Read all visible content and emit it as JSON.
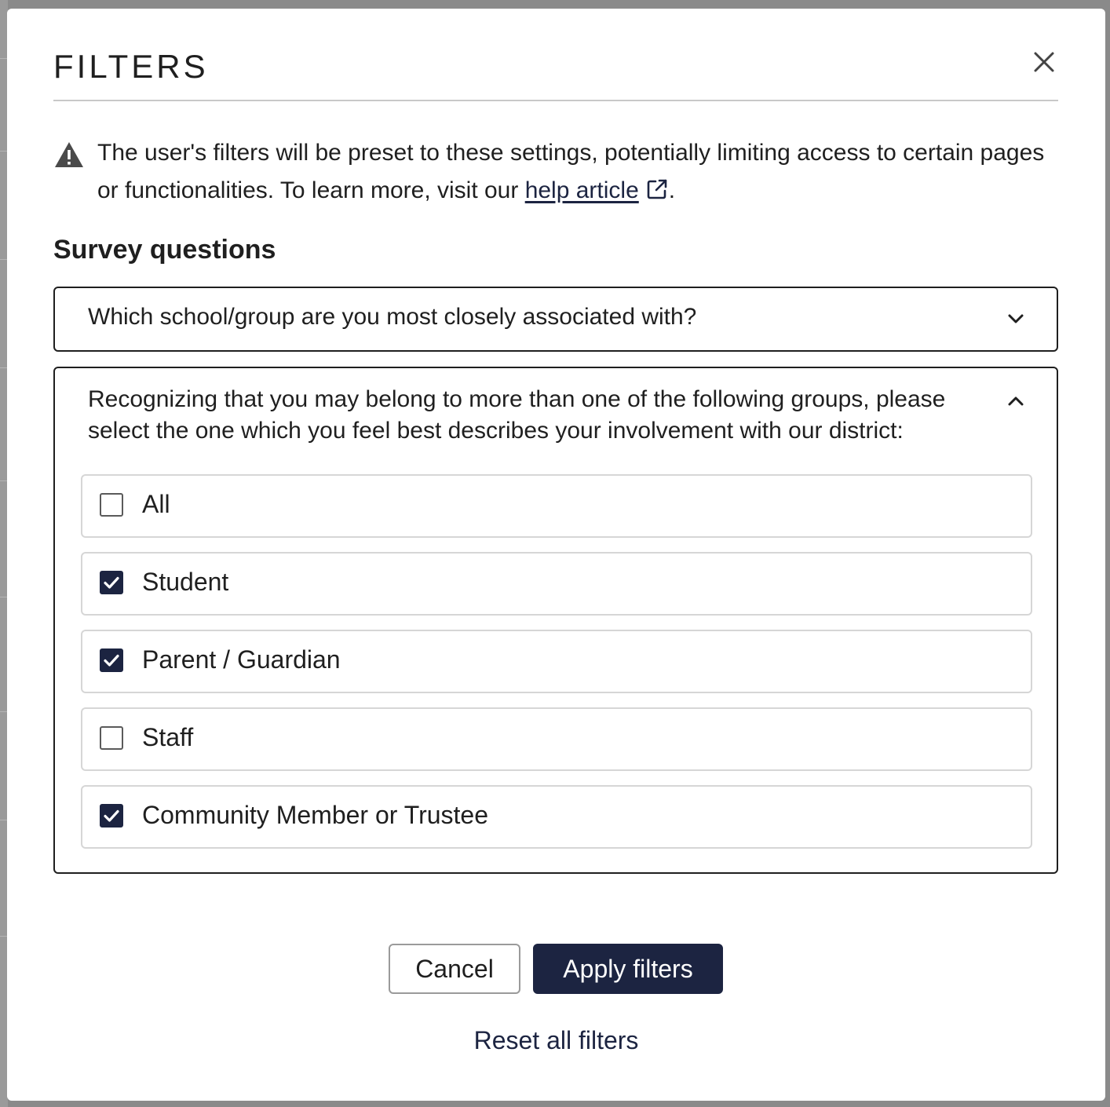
{
  "modal": {
    "title": "FILTERS",
    "close_icon": "close-icon"
  },
  "notice": {
    "icon": "warning-icon",
    "text_before": "The user's filters will be preset to these settings, potentially limiting access to certain pages or functionalities. To learn more, visit our ",
    "link_text": "help article",
    "link_icon": "external-link-icon",
    "text_after": "."
  },
  "section": {
    "heading": "Survey questions"
  },
  "questions": [
    {
      "label": "Which school/group are you most closely associated with?",
      "expanded": false,
      "icon": "chevron-down-icon"
    },
    {
      "label": "Recognizing that you may belong to more than one of the following groups, please select the one which you feel best describes your involvement with our district:",
      "expanded": true,
      "icon": "chevron-up-icon",
      "options": [
        {
          "label": "All",
          "checked": false
        },
        {
          "label": "Student",
          "checked": true
        },
        {
          "label": "Parent / Guardian",
          "checked": true
        },
        {
          "label": "Staff",
          "checked": false
        },
        {
          "label": "Community Member or Trustee",
          "checked": true
        }
      ]
    }
  ],
  "footer": {
    "cancel_label": "Cancel",
    "apply_label": "Apply filters",
    "reset_label": "Reset all filters"
  },
  "colors": {
    "primary": "#1c2441",
    "border": "#1f1f1f",
    "option_border": "#d6d6d6",
    "divider": "#c8c8c8"
  }
}
